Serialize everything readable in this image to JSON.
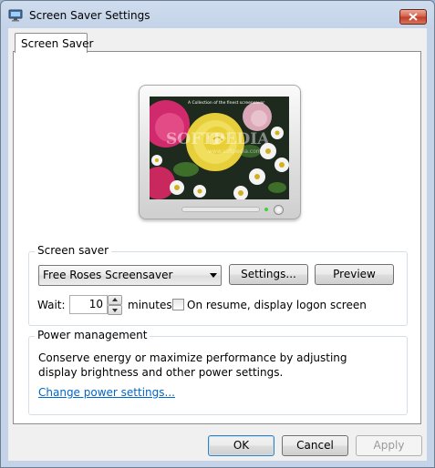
{
  "window": {
    "title": "Screen Saver Settings",
    "icon": "display-settings-icon",
    "close_icon": "close-icon"
  },
  "tabs": [
    {
      "label": "Screen Saver",
      "selected": true
    }
  ],
  "preview": {
    "watermark": "SOFTPEDIA",
    "watermark_url": "www.softpedia.com",
    "caption": "A Collection of the finest screensaver"
  },
  "screen_saver": {
    "group_label": "Screen saver",
    "selected": "Free Roses Screensaver",
    "settings_label": "Settings...",
    "preview_label": "Preview",
    "wait_label": "Wait:",
    "wait_value": "10",
    "minutes_label": "minutes",
    "resume_label": "On resume, display logon screen",
    "resume_checked": false
  },
  "power": {
    "group_label": "Power management",
    "description": "Conserve energy or maximize performance by adjusting display brightness and other power settings.",
    "link_label": "Change power settings..."
  },
  "footer": {
    "ok_label": "OK",
    "cancel_label": "Cancel",
    "apply_label": "Apply",
    "apply_enabled": false
  },
  "colors": {
    "link": "#0066cc",
    "frame": "#c4d3e8",
    "close": "#c23b24"
  }
}
